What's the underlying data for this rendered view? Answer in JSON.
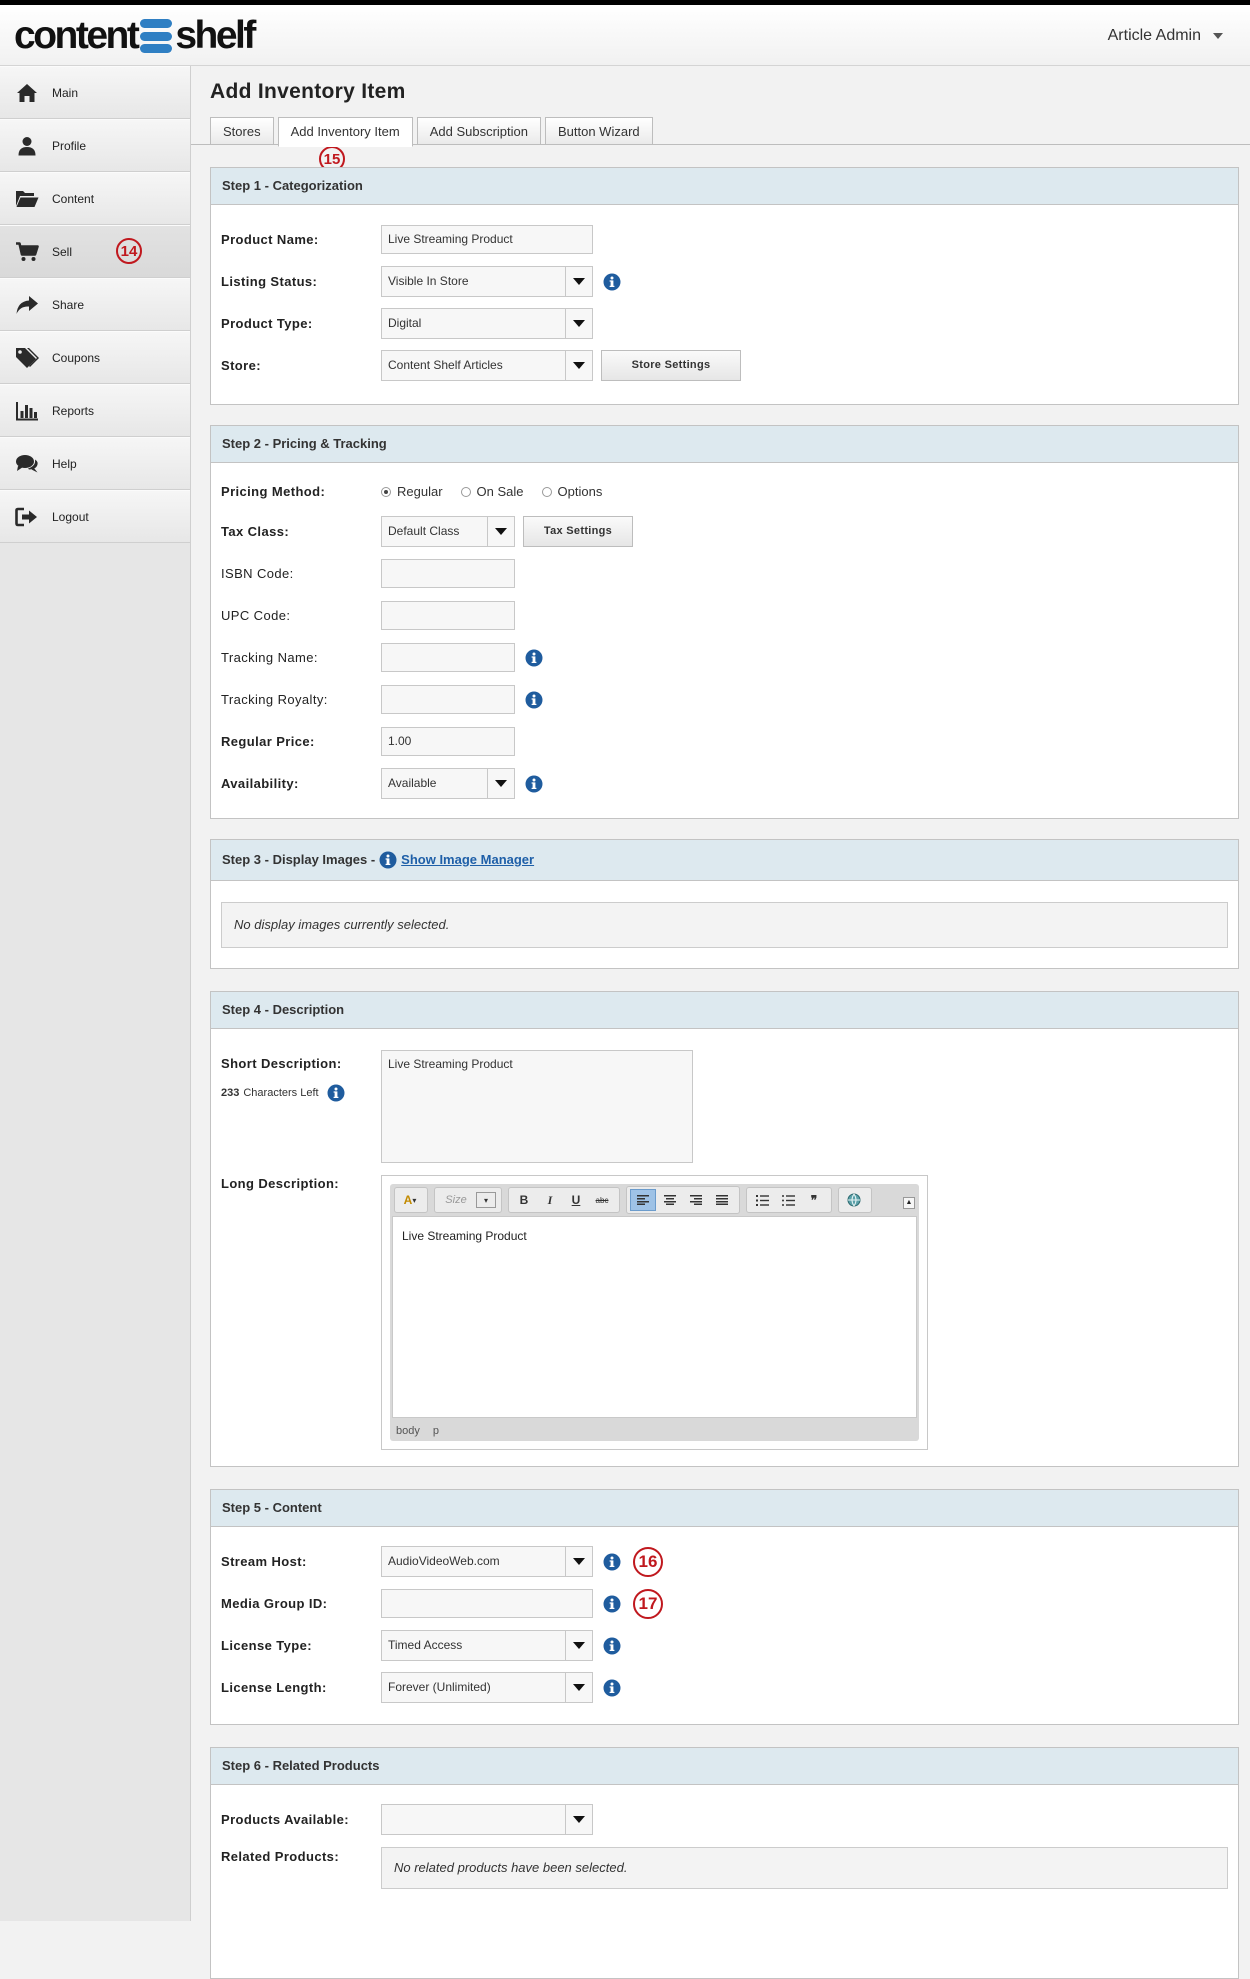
{
  "app": {
    "logo_left": "content",
    "logo_right": "shelf",
    "user_menu": "Article Admin"
  },
  "sidebar": {
    "items": [
      {
        "label": "Main",
        "icon": "home-icon"
      },
      {
        "label": "Profile",
        "icon": "user-icon"
      },
      {
        "label": "Content",
        "icon": "folder-icon"
      },
      {
        "label": "Sell",
        "icon": "cart-icon",
        "callout": "14"
      },
      {
        "label": "Share",
        "icon": "share-icon"
      },
      {
        "label": "Coupons",
        "icon": "tags-icon"
      },
      {
        "label": "Reports",
        "icon": "bar-chart-icon"
      },
      {
        "label": "Help",
        "icon": "chat-icon"
      },
      {
        "label": "Logout",
        "icon": "logout-icon"
      }
    ]
  },
  "page": {
    "title": "Add Inventory Item",
    "tabs": [
      "Stores",
      "Add Inventory Item",
      "Add Subscription",
      "Button Wizard"
    ],
    "active_tab": "Add Inventory Item",
    "tab_callout": "15"
  },
  "step1": {
    "title": "Step 1 - Categorization",
    "product_name_label": "Product Name:",
    "product_name_value": "Live Streaming Product",
    "listing_status_label": "Listing Status:",
    "listing_status_value": "Visible In Store",
    "product_type_label": "Product Type:",
    "product_type_value": "Digital",
    "store_label": "Store:",
    "store_value": "Content Shelf Articles",
    "store_settings_button": "Store Settings"
  },
  "step2": {
    "title": "Step 2 - Pricing & Tracking",
    "pricing_method_label": "Pricing Method:",
    "pricing_options": [
      "Regular",
      "On Sale",
      "Options"
    ],
    "pricing_selected": "Regular",
    "tax_class_label": "Tax Class:",
    "tax_class_value": "Default Class",
    "tax_settings_button": "Tax Settings",
    "isbn_label": "ISBN Code:",
    "upc_label": "UPC Code:",
    "tracking_name_label": "Tracking Name:",
    "tracking_royalty_label": "Tracking Royalty:",
    "regular_price_label": "Regular Price:",
    "regular_price_value": "1.00",
    "availability_label": "Availability:",
    "availability_value": "Available"
  },
  "step3": {
    "title": "Step 3 - Display Images - ",
    "link": "Show Image Manager",
    "empty_text": "No display images currently selected."
  },
  "step4": {
    "title": "Step 4 - Description",
    "short_label": "Short Description:",
    "chars_count": "233",
    "chars_text": "Characters Left",
    "short_value": "Live Streaming Product",
    "long_label": "Long Description:",
    "long_value": "Live Streaming Product",
    "size_placeholder": "Size",
    "status_path": [
      "body",
      "p"
    ]
  },
  "step5": {
    "title": "Step 5 - Content",
    "stream_host_label": "Stream Host:",
    "stream_host_value": "AudioVideoWeb.com",
    "stream_callout": "16",
    "media_group_label": "Media Group ID:",
    "media_callout": "17",
    "license_type_label": "License Type:",
    "license_type_value": "Timed Access",
    "license_length_label": "License Length:",
    "license_length_value": "Forever (Unlimited)"
  },
  "step6": {
    "title": "Step 6 - Related Products",
    "available_label": "Products Available:",
    "related_label": "Related Products:",
    "related_empty": "No related products have been selected."
  },
  "colors": {
    "panel_header": "#dde9ef",
    "info_icon": "#1f5c9e",
    "callout": "#c0181e",
    "logo_mark": "#2f7fc3"
  }
}
